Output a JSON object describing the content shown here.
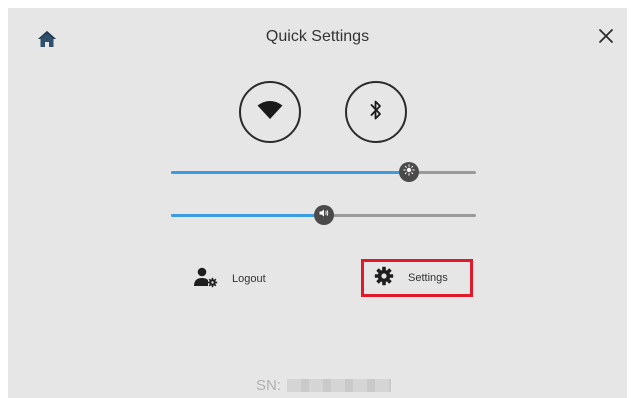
{
  "header": {
    "title": "Quick Settings"
  },
  "toggles": {
    "wifi_icon": "wifi-icon",
    "bluetooth_icon": "bluetooth-icon"
  },
  "sliders": {
    "brightness": {
      "icon": "sun-icon",
      "value_fraction": 0.78
    },
    "volume": {
      "icon": "speaker-icon",
      "value_fraction": 0.5
    }
  },
  "actions": {
    "logout_label": "Logout",
    "settings_label": "Settings"
  },
  "footer": {
    "sn_label": "SN:",
    "sn_value": ""
  },
  "colors": {
    "background": "#e6e6e6",
    "accent": "#3b9de0",
    "highlight": "#e11a2b",
    "icon": "#2b2b2b"
  }
}
